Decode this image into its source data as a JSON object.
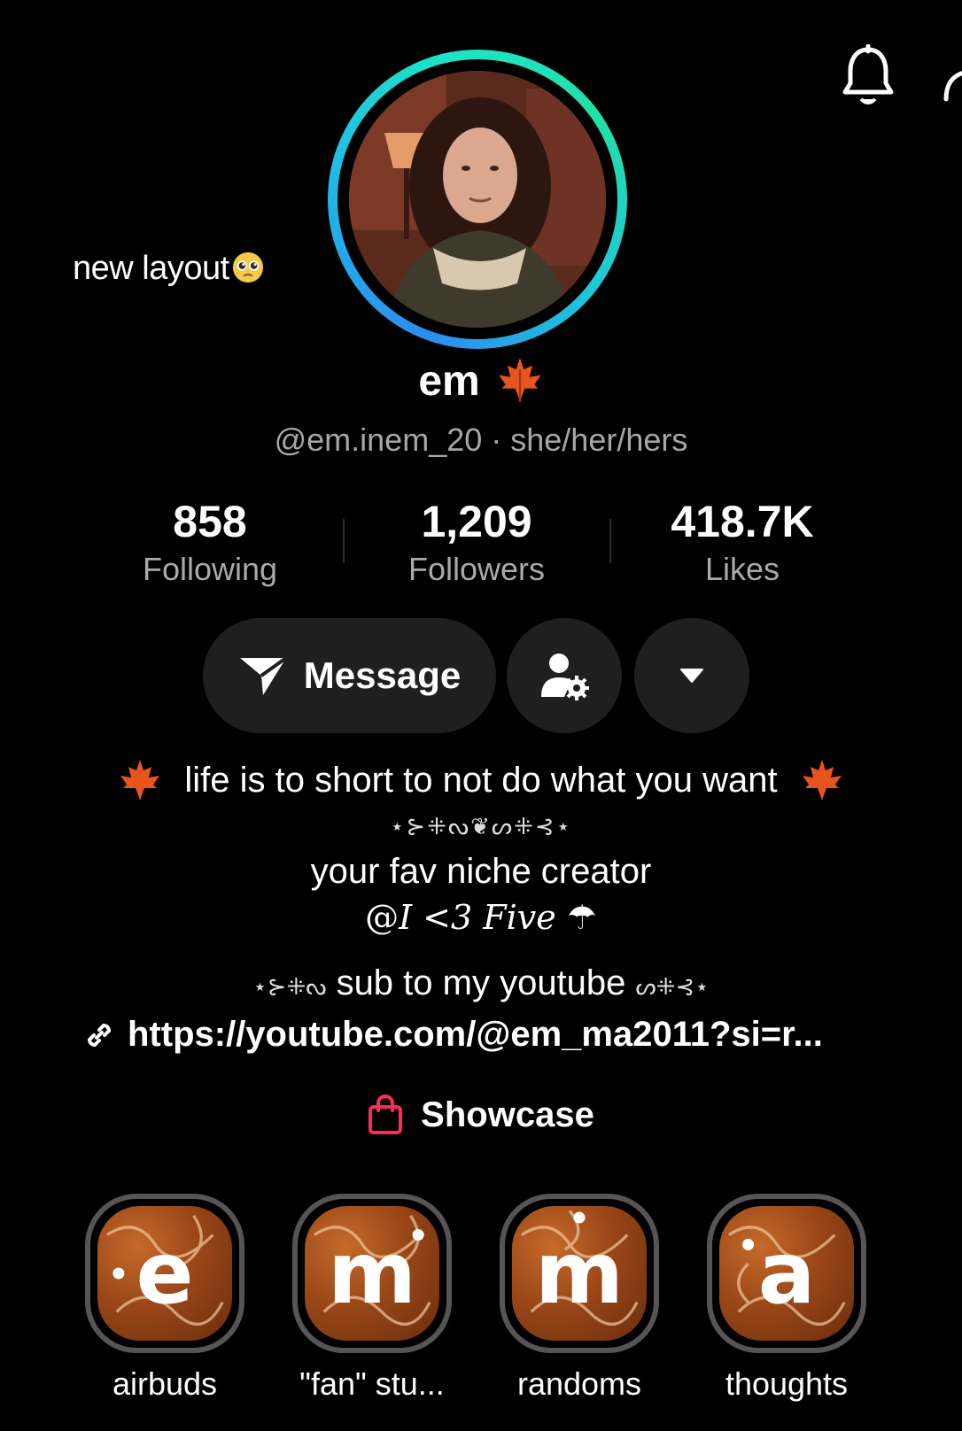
{
  "caption": "new layout",
  "caption_emoji": "pleading-face-emoji",
  "profile": {
    "name": "em",
    "name_emoji": "maple-leaf-emoji",
    "handle": "@em.inem_20",
    "pronouns": "she/her/hers",
    "handle_separator": " · "
  },
  "stats": [
    {
      "value": "858",
      "label": "Following"
    },
    {
      "value": "1,209",
      "label": "Followers"
    },
    {
      "value": "418.7K",
      "label": "Likes"
    }
  ],
  "actions": {
    "message_label": "Message",
    "profile_settings_icon": "person-gear-icon",
    "more_icon": "caret-down-icon"
  },
  "bio": {
    "line1": "life is to short to not do what you want",
    "ornament": "⋆⊱⁜ᔓ❦ᔕ⁜⊰⋆",
    "line2": "your fav niche creator",
    "line3_prefix": "@",
    "line3_main": "I <3 Five",
    "line3_icon": "☂",
    "line4_left": "⋆⊱⁜ᔓ",
    "line4_text": "sub to my youtube",
    "line4_right": "ᔕ⁜⊰⋆",
    "link": "https://youtube.com/@em_ma2011?si=r..."
  },
  "showcase_label": "Showcase",
  "highlights": [
    {
      "letter": "e",
      "label": "airbuds"
    },
    {
      "letter": "m",
      "label": "\"fan\" stu..."
    },
    {
      "letter": "m",
      "label": "randoms"
    },
    {
      "letter": "a",
      "label": "thoughts"
    }
  ],
  "colors": {
    "background": "#000000",
    "ring_blue": "#2d8cf0",
    "ring_green": "#1ee3c8",
    "showcase_bag": "#fe2c55",
    "secondary_text": "#a6a6a6",
    "button_bg": "#1f1f1f"
  }
}
